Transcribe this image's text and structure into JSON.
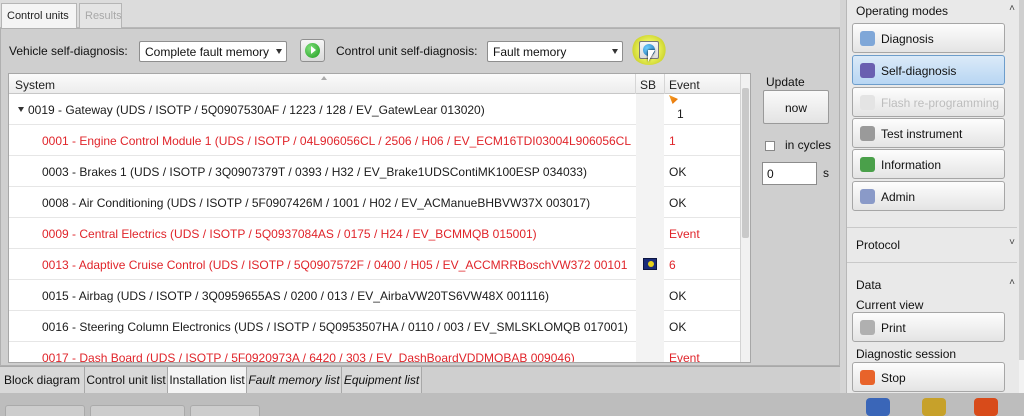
{
  "tabs": [
    {
      "label": "Control units",
      "active": true
    },
    {
      "label": "Results",
      "active": false
    }
  ],
  "toolbar": {
    "vehicle_label": "Vehicle self-diagnosis:",
    "vehicle_select": "Complete fault memory",
    "control_label": "Control unit self-diagnosis:",
    "control_select": "Fault memory"
  },
  "table": {
    "headers": {
      "system": "System",
      "sb": "SB",
      "event": "Event"
    },
    "rows": [
      {
        "system": "0019 - Gateway  (UDS / ISOTP / 5Q0907530AF / 1223 / 128 / EV_GatewLear 013020)",
        "event": "1",
        "status": "gateway"
      },
      {
        "system": "0001 - Engine Control Module 1  (UDS / ISOTP / 04L906056CL / 2506 / H06 / EV_ECM16TDI03004L906056CL",
        "event": "1",
        "status": "fault"
      },
      {
        "system": "0003 - Brakes 1  (UDS / ISOTP / 3Q0907379T / 0393 / H32 / EV_Brake1UDSContiMK100ESP 034033)",
        "event": "OK",
        "status": "ok"
      },
      {
        "system": "0008 - Air Conditioning  (UDS / ISOTP / 5F0907426M / 1001 / H02 / EV_ACManueBHBVW37X 003017)",
        "event": "OK",
        "status": "ok"
      },
      {
        "system": "0009 - Central Electrics  (UDS / ISOTP / 5Q0937084AS / 0175 / H24 / EV_BCMMQB 015001)",
        "event": "Event",
        "status": "fault"
      },
      {
        "system": "0013 - Adaptive Cruise Control  (UDS / ISOTP / 5Q0907572F / 0400 / H05 / EV_ACCMRRBoschVW372 00101",
        "event": "6",
        "status": "fault"
      },
      {
        "system": "0015 - Airbag  (UDS / ISOTP / 3Q0959655AS / 0200 / 013 / EV_AirbaVW20TS6VW48X 001116)",
        "event": "OK",
        "status": "ok"
      },
      {
        "system": "0016 - Steering Column Electronics  (UDS / ISOTP / 5Q0953507HA / 0110 / 003 / EV_SMLSKLOMQB 017001)",
        "event": "OK",
        "status": "ok"
      },
      {
        "system": "0017 - Dash Board  (UDS / ISOTP / 5F0920973A / 6420 / 303 / EV_DashBoardVDDMQBAB 009046)",
        "event": "Event",
        "status": "fault"
      }
    ]
  },
  "update": {
    "title": "Update",
    "now_label": "now",
    "cycles_label": "in cycles",
    "cycles_value": "0",
    "unit": "s"
  },
  "bottom_tabs": [
    {
      "label": "Block diagram",
      "italic": false,
      "active": false
    },
    {
      "label": "Control unit list",
      "italic": false,
      "active": false
    },
    {
      "label": "Installation list",
      "italic": false,
      "active": true
    },
    {
      "label": "Fault memory list",
      "italic": true,
      "active": false
    },
    {
      "label": "Equipment list",
      "italic": true,
      "active": false
    }
  ],
  "right_panel": {
    "operating_modes_title": "Operating modes",
    "modes": [
      {
        "label": "Diagnosis",
        "icon": "stethoscope-icon",
        "state": "normal"
      },
      {
        "label": "Self-diagnosis",
        "icon": "car-diagnosis-icon",
        "state": "active"
      },
      {
        "label": "Flash re-programming",
        "icon": "flash-icon",
        "state": "disabled"
      },
      {
        "label": "Test instrument",
        "icon": "gauge-icon",
        "state": "normal"
      },
      {
        "label": "Information",
        "icon": "info-book-icon",
        "state": "normal"
      },
      {
        "label": "Admin",
        "icon": "admin-gear-icon",
        "state": "normal"
      }
    ],
    "protocol_title": "Protocol",
    "data_title": "Data",
    "current_view_label": "Current view",
    "print_label": "Print",
    "diagnostic_session_label": "Diagnostic session",
    "stop_label": "Stop"
  },
  "colors": {
    "fault_text": "#e0242a",
    "active_mode": "#b8d6f3",
    "highlight": "#e6ee3c"
  }
}
